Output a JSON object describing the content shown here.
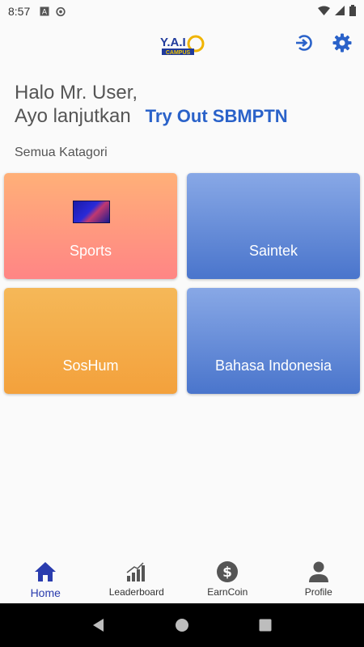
{
  "status_bar": {
    "time": "8:57",
    "icons": [
      "text-box-icon",
      "circle-a-icon",
      "wifi-icon",
      "signal-icon",
      "battery-icon"
    ]
  },
  "app_bar": {
    "logo_text": "Y.A.I",
    "logo_subtext": "CAMPUS",
    "actions": [
      "logout-icon",
      "settings-icon"
    ],
    "accent_color": "#2a62c9"
  },
  "greeting": {
    "line1": "Halo Mr. User,",
    "line2": "Ayo lanjutkan",
    "highlight": "Try Out SBMPTN"
  },
  "section": {
    "label": "Semua Katagori"
  },
  "categories": [
    {
      "label": "Sports",
      "color_top": "#ffb078",
      "color_bottom": "#ff8585"
    },
    {
      "label": "Saintek",
      "color_top": "#88a8e6",
      "color_bottom": "#4a75cc"
    },
    {
      "label": "SosHum",
      "color_top": "#f5b858",
      "color_bottom": "#f3a13c"
    },
    {
      "label": "Bahasa Indonesia",
      "color_top": "#88a8e6",
      "color_bottom": "#4a75cc"
    }
  ],
  "bottom_nav": {
    "items": [
      {
        "label": "Home",
        "icon": "home-icon",
        "active": true
      },
      {
        "label": "Leaderboard",
        "icon": "bar-chart-icon",
        "active": false
      },
      {
        "label": "EarnCoin",
        "icon": "dollar-coin-icon",
        "active": false
      },
      {
        "label": "Profile",
        "icon": "person-icon",
        "active": false
      }
    ],
    "active_color": "#2a3cae"
  }
}
